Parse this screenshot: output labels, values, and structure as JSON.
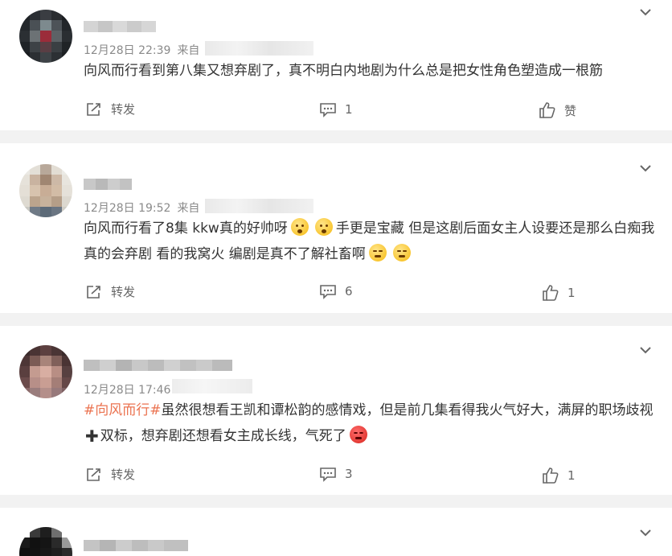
{
  "colors": {
    "accent": "#eb7350",
    "meta": "#8a8a8a",
    "separator": "#f2f2f2"
  },
  "comments": [
    {
      "time": "12月28日 22:39",
      "source_label": "来自",
      "text_plain": "向风而行看到第八集又想弃剧了，真不明白内地剧为什么总是把女性角色塑造成一根筋",
      "repost_label": "转发",
      "reply_count": "1",
      "like_label": "赞"
    },
    {
      "time": "12月28日 19:52",
      "source_label": "来自",
      "text_a": "向风而行看了8集 kkw真的好帅呀",
      "text_b": "手更是宝藏 但是这剧后面女主人设要还是那么白痴我真的会弃剧 看的我窝火 编剧是真不了解社畜啊",
      "repost_label": "转发",
      "reply_count": "6",
      "like_count": "1"
    },
    {
      "time": "12月28日 17:46",
      "hashtag": "#向风而行#",
      "text_a": "虽然很想看王凯和谭松韵的感情戏，但是前几集看得我火气好大，满屏的职场歧视",
      "text_b": "双标，想弃剧还想看女主成长线，气死了",
      "repost_label": "转发",
      "reply_count": "3",
      "like_count": "1"
    }
  ],
  "icons": {
    "expand": "chevron-down-icon",
    "repost": "repost-icon",
    "comment": "comment-icon",
    "like": "thumbs-up-icon"
  }
}
